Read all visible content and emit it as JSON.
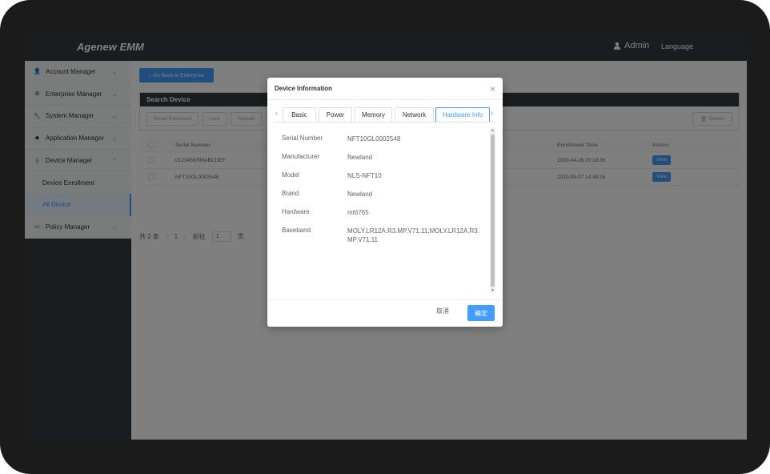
{
  "header": {
    "brand": "Agenew EMM",
    "user": "Admin",
    "language": "Language"
  },
  "sidebar": {
    "items": [
      {
        "label": "Account Manager",
        "icon": "user-icon"
      },
      {
        "label": "Enterprise Manager",
        "icon": "enterprise-icon"
      },
      {
        "label": "System Manager",
        "icon": "wrench-icon"
      },
      {
        "label": "Application Manager",
        "icon": "app-icon"
      },
      {
        "label": "Device Manager",
        "icon": "phone-icon"
      }
    ],
    "device_sub": [
      "Device Enrollment",
      "All Device"
    ],
    "policy": {
      "label": "Policy Manager",
      "icon": "monitor-icon"
    }
  },
  "main": {
    "back_button": "Go Back to Enterprise",
    "search_title": "Search Device",
    "toolbar": [
      "Reset Password",
      "Lock",
      "Reboot"
    ],
    "delete_button": "Delete",
    "table": {
      "headers": {
        "serial": "Serial Number",
        "enrollment": "Enrollment Time",
        "action": "Action"
      },
      "rows": [
        {
          "serial": "0123456789ABCDEF",
          "enrollment": "2020-04-26 20:18:36",
          "action": "View"
        },
        {
          "serial": "NFT10GL0002548",
          "enrollment": "2020-05-07 14:48:15",
          "action": "View"
        }
      ]
    },
    "pager": {
      "total": "共 2 条",
      "page": "1",
      "goto": "前往",
      "goto_value": "1",
      "unit": "页"
    }
  },
  "dialog": {
    "title": "Device Information",
    "tabs": [
      "Basic",
      "Power",
      "Memory",
      "Network",
      "Hardware Info"
    ],
    "active_tab": "Hardware Info",
    "fields": [
      {
        "label": "Serial Number",
        "value": "NFT10GL0002548"
      },
      {
        "label": "Manufacturer",
        "value": "Newland"
      },
      {
        "label": "Model",
        "value": "NLS-NFT10"
      },
      {
        "label": "Brand",
        "value": "Newland"
      },
      {
        "label": "Hardware",
        "value": "mt6765"
      },
      {
        "label": "Baseband",
        "value": "MOLY.LR12A.R3.MP.V71.11,MOLY.LR12A.R3.MP.V71.11"
      }
    ],
    "cancel": "取消",
    "confirm": "确定"
  },
  "colors": {
    "primary": "#409eff",
    "dark": "#343a40"
  }
}
